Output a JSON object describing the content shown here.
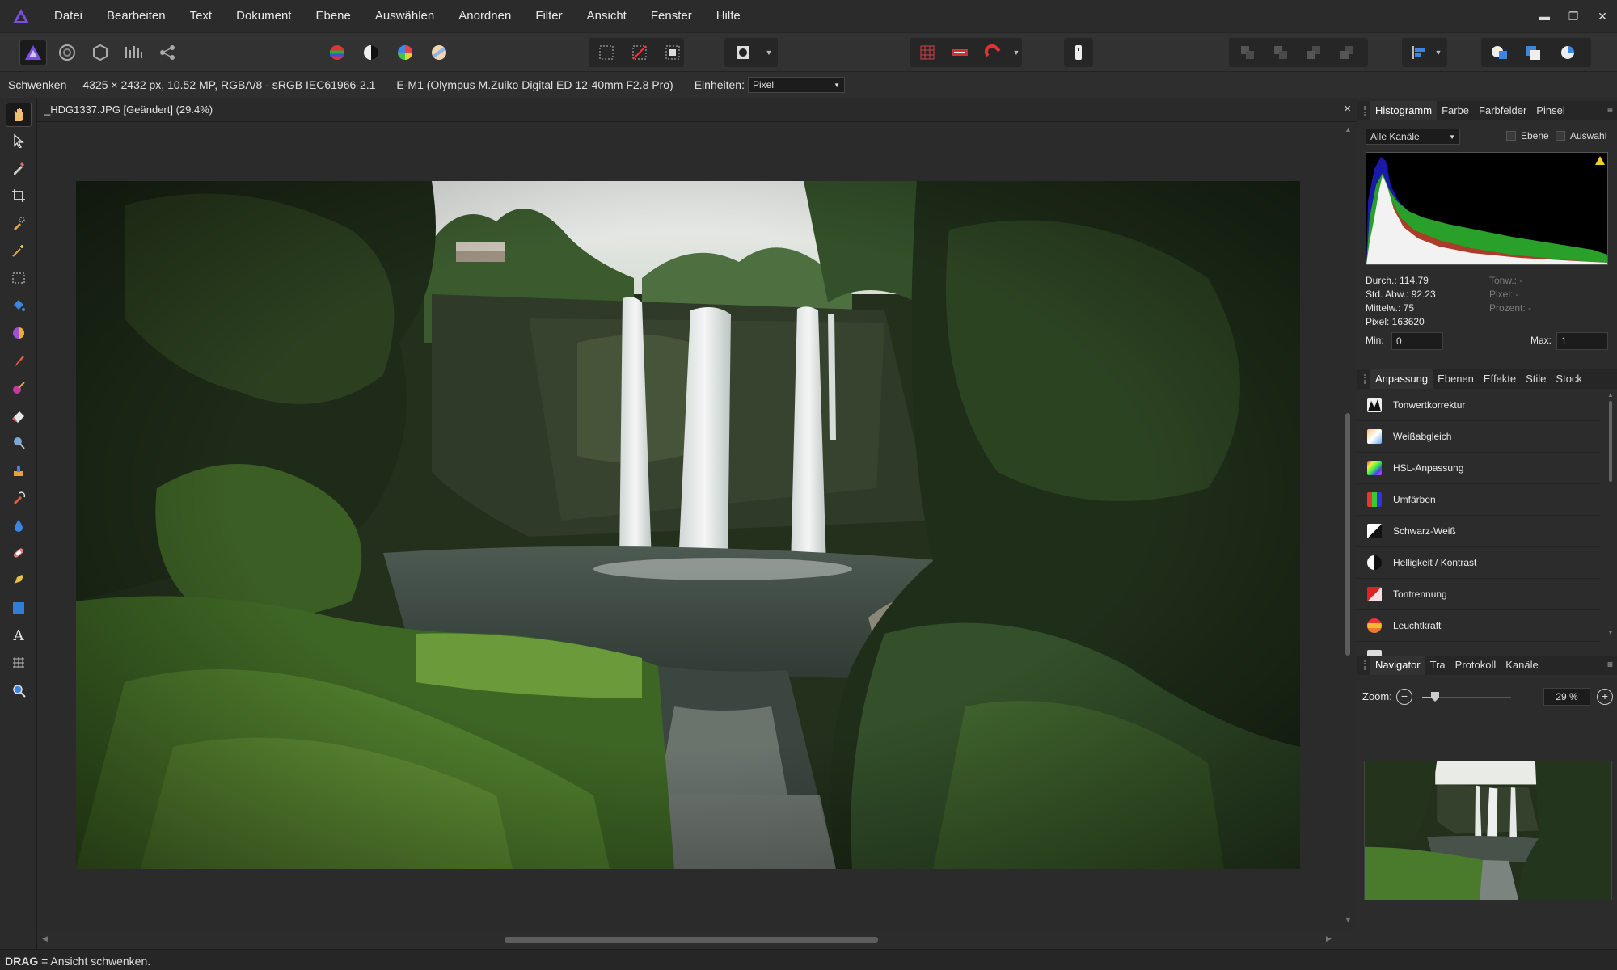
{
  "app": {
    "menu": [
      "Datei",
      "Bearbeiten",
      "Text",
      "Dokument",
      "Ebene",
      "Auswählen",
      "Anordnen",
      "Filter",
      "Ansicht",
      "Fenster",
      "Hilfe"
    ]
  },
  "context_bar": {
    "tool_name": "Schwenken",
    "image_info": "4325 × 2432 px, 10.52 MP, RGBA/8 - sRGB IEC61966-2.1",
    "camera_info": "E-M1 (Olympus M.Zuiko Digital ED 12-40mm F2.8 Pro)",
    "units_label": "Einheiten:",
    "units_value": "Pixel"
  },
  "document": {
    "tab_title": "_HDG1337.JPG [Geändert] (29.4%)",
    "close_glyph": "×"
  },
  "histogram_panel": {
    "tabs": [
      "Histogramm",
      "Farbe",
      "Farbfelder",
      "Pinsel"
    ],
    "channel_select": "Alle Kanäle",
    "checkbox_layer": "Ebene",
    "checkbox_selection": "Auswahl",
    "stats_left": [
      "Durch.: 114.79",
      "Std. Abw.: 92.23",
      "Mittelw.: 75",
      "Pixel: 163620"
    ],
    "stats_right": [
      "Tonw.: -",
      "Pixel: -",
      "Prozent: -"
    ],
    "min_label": "Min:",
    "min_value": "0",
    "max_label": "Max:",
    "max_value": "1",
    "warning_icon": "warning-triangle-icon"
  },
  "adjustment_panel": {
    "tabs": [
      "Anpassung",
      "Ebenen",
      "Effekte",
      "Stile",
      "Stock"
    ],
    "items": [
      {
        "label": "Tonwertkorrektur",
        "icon": "levels-icon"
      },
      {
        "label": "Weißabgleich",
        "icon": "white-balance-icon"
      },
      {
        "label": "HSL-Anpassung",
        "icon": "hsl-icon"
      },
      {
        "label": "Umfärben",
        "icon": "recolor-icon"
      },
      {
        "label": "Schwarz-Weiß",
        "icon": "black-white-icon"
      },
      {
        "label": "Helligkeit / Kontrast",
        "icon": "brightness-contrast-icon"
      },
      {
        "label": "Tontrennung",
        "icon": "split-toning-icon"
      },
      {
        "label": "Leuchtkraft",
        "icon": "vibrance-icon"
      }
    ]
  },
  "navigator_panel": {
    "tabs": [
      "Navigator",
      "Tra",
      "Protokoll",
      "Kanäle"
    ],
    "zoom_label": "Zoom:",
    "zoom_value": "29 %",
    "zoom_level": 0.29
  },
  "status_bar": {
    "key": "DRAG",
    "text": " = Ansicht schwenken."
  },
  "colors": {
    "accent": "#5b3fc4",
    "panel_bg": "#2c2c2c",
    "canvas_bg": "#2b2b2b"
  }
}
